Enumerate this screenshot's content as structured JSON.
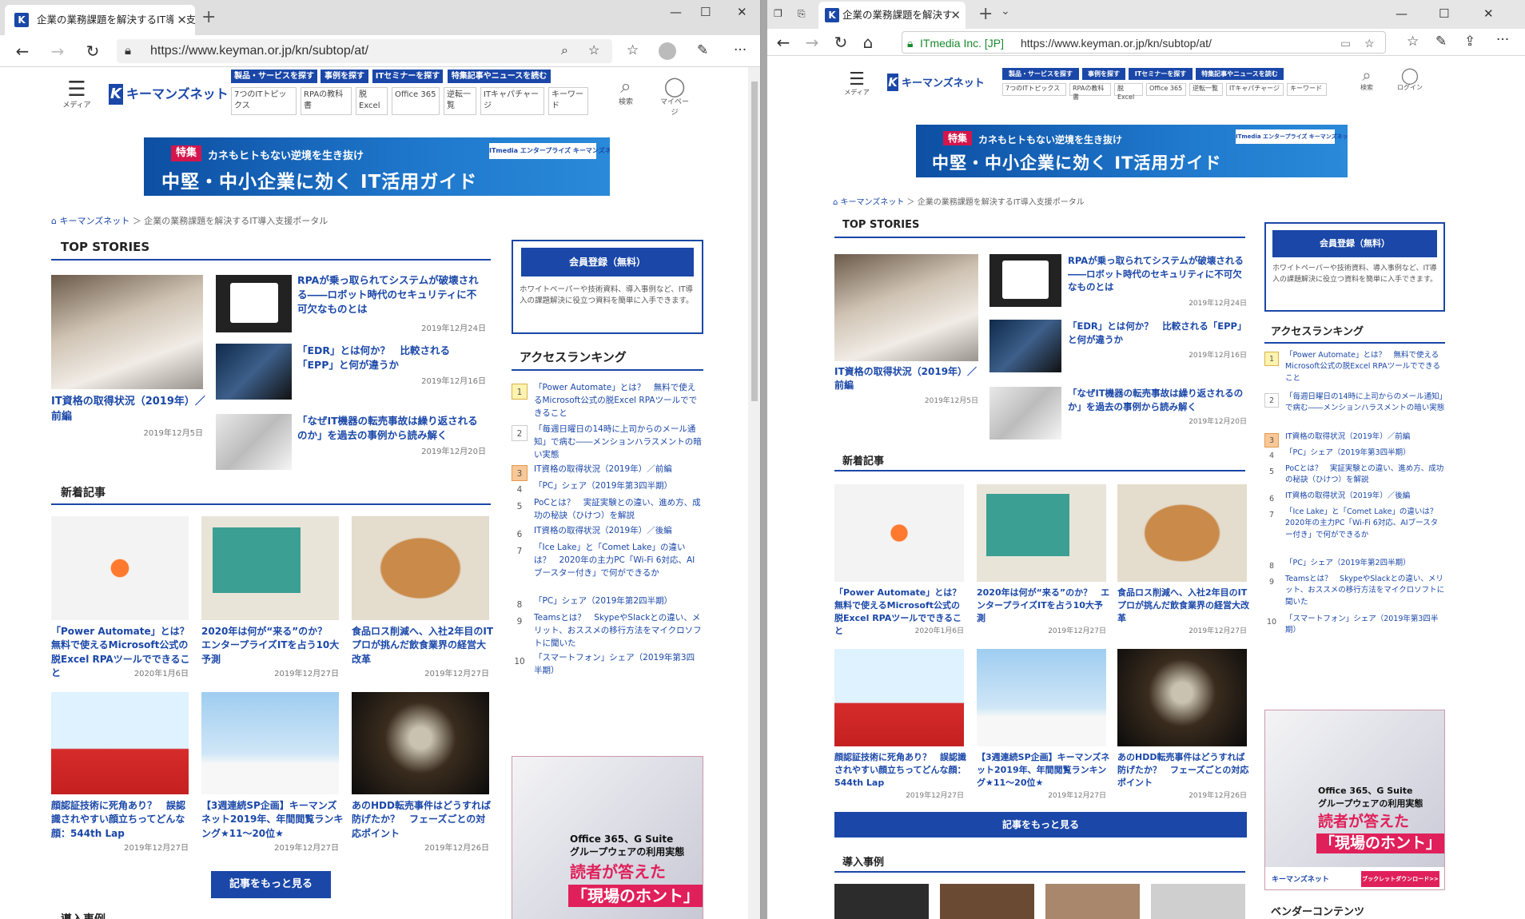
{
  "colors": {
    "accent": "#1a47a8",
    "rank1": "#fff3b0",
    "rank3": "#f9c897",
    "banner_tag": "#d4164c"
  },
  "left": {
    "tab_title": "企業の業務課題を解決するIT導入支援ポータル - キーマンズネット",
    "url": "https://www.keyman.or.jp/kn/subtop/at/"
  },
  "right": {
    "tab_title": "企業の業務課題を解決す",
    "site_identity": "ITmedia Inc. [JP]",
    "url": "https://www.keyman.or.jp/kn/subtop/at/"
  },
  "header": {
    "menu_label": "メディア",
    "logo_text": "キーマンズネット",
    "logo_mark": "K",
    "nav": [
      "製品・サービスを探す",
      "事例を探す",
      "ITセミナーを探す",
      "特集記事やニュースを読む"
    ],
    "subnav": [
      "7つのITトピックス",
      "RPAの教科書",
      "脱Excel",
      "Office 365",
      "逆転一覧",
      "ITキャパチャージ",
      "キーワード"
    ],
    "subnav_left": [
      "7つのITトピックス",
      "RPAの教科書",
      "脱Excel",
      "Office 365",
      "逆転一覧",
      "ITキャパチャージ",
      "キーワード"
    ],
    "search_label": "検索",
    "mypage_label": "マイページ",
    "login_label": "ログイン"
  },
  "banner": {
    "tag": "特集",
    "subtitle": "カネもヒトもない逆境を生き抜け",
    "title": "中堅・中小企業に効く IT活用ガイド",
    "badge": "ITmedia エンタープライズ  キーマンズネット"
  },
  "breadcrumb": {
    "home": "キーマンズネット",
    "current": "企業の業務課題を解決するIT導入支援ポータル"
  },
  "top_stories": {
    "heading": "TOP STORIES",
    "main": {
      "title": "IT資格の取得状況（2019年）／前編",
      "date": "2019年12月5日"
    },
    "items": [
      {
        "title": "RPAが乗っ取られてシステムが破壊される――ロボット時代のセキュリティに不可欠なものとは",
        "date": "2019年12月24日"
      },
      {
        "title": "「EDR」とは何か？　比較される「EPP」と何が違うか",
        "date": "2019年12月16日"
      },
      {
        "title": "「なぜIT機器の転売事故は繰り返されるのか」を過去の事例から読み解く",
        "date": "2019年12月20日"
      }
    ]
  },
  "new_articles": {
    "heading": "新着記事",
    "items": [
      {
        "title": "「Power Automate」とは？　無料で使えるMicrosoft公式の脱Excel RPAツールでできること",
        "date": "2020年1月6日"
      },
      {
        "title": "2020年は何が“来る”のか？　エンタープライズITを占う10大予測",
        "date": "2019年12月27日"
      },
      {
        "title": "食品ロス削減へ、入社2年目のITプロが挑んだ飲食業界の経営大改革",
        "date": "2019年12月27日"
      },
      {
        "title": "顔認証技術に死角あり？　誤認識されやすい顔立ちってどんな顔：544th Lap",
        "date": "2019年12月27日"
      },
      {
        "title": "【3週連続SP企画】キーマンズネット2019年、年間閲覧ランキング★11～20位★",
        "date": "2019年12月27日"
      },
      {
        "title": "あのHDD転売事件はどうすれば防げたか？　フェーズごとの対応ポイント",
        "date": "2019年12月26日"
      }
    ],
    "more_label": "記事をもっと見る"
  },
  "case_heading": "導入事例",
  "vendor_heading": "ベンダーコンテンツ",
  "member": {
    "button": "会員登録（無料）",
    "text": "ホワイトペーパーや技術資料、導入事例など、IT導入の課題解決に役立つ資料を簡単に入手できます。"
  },
  "ranking": {
    "heading": "アクセスランキング",
    "items": [
      {
        "n": "1",
        "title": "「Power Automate」とは？　無料で使えるMicrosoft公式の脱Excel RPAツールでできること"
      },
      {
        "n": "2",
        "title": "「毎週日曜日の14時に上司からのメール通知」で病む――メンションハラスメントの暗い実態"
      },
      {
        "n": "3",
        "title": "IT資格の取得状況（2019年）／前編"
      },
      {
        "n": "4",
        "title": "「PC」シェア（2019年第3四半期）"
      },
      {
        "n": "5",
        "title": "PoCとは？　実証実験との違い、進め方、成功の秘訣（ひけつ）を解説"
      },
      {
        "n": "6",
        "title": "IT資格の取得状況（2019年）／後編"
      },
      {
        "n": "7",
        "title": "「Ice Lake」と「Comet Lake」の違いは？　2020年の主力PC「Wi-Fi 6対応、AIブースター付き」で何ができるか"
      },
      {
        "n": "8",
        "title": "「PC」シェア（2019年第2四半期）"
      },
      {
        "n": "9",
        "title": "Teamsとは？　SkypeやSlackとの違い、メリット、おススメの移行方法をマイクロソフトに聞いた"
      },
      {
        "n": "10",
        "title": "「スマートフォン」シェア（2019年第3四半期）"
      }
    ]
  },
  "ad": {
    "line1": "Office 365、G Suite",
    "line2": "グループウェアの利用実態",
    "line3": "読者が答えた",
    "line4": "「現場のホント」",
    "footer_logo": "キーマンズネット",
    "footer_btn": "ブックレットダウンロード>>"
  }
}
